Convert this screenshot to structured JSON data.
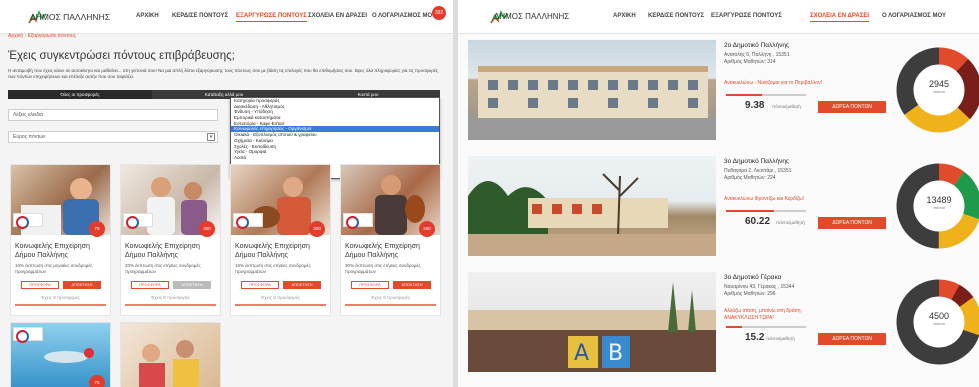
{
  "brand": {
    "name": "ΔΗΜΟΣ ΠΑΛΛΗΝΗΣ",
    "colors": {
      "accent": "#e14a2b",
      "badge": "#e53b2c",
      "dark": "#3a3a3a"
    }
  },
  "nav": [
    {
      "label": "ΑΡΧΙΚΗ"
    },
    {
      "label": "ΚΕΡΔΙΣΕ ΠΟΝΤΟΥΣ"
    },
    {
      "label": "ΕΞΑΡΓΥΡΩΣΕ ΠΟΝΤΟΥΣ"
    },
    {
      "label": "ΣΧΟΛΕΙΑ ΕΝ ΔΡΑΣΕΙ"
    },
    {
      "label": "Ο ΛΟΓΑΡΙΑΣΜΟΣ ΜΟΥ"
    }
  ],
  "account_badge": "392",
  "breadcrumb": {
    "home": "Αρχική",
    "current": "Εξαργύρωσε πόντους"
  },
  "left": {
    "title": "Έχεις συγκεντρώσει πόντους επιβράβευσης;",
    "intro": "Η ανταμοιβή που έχεις κάνει σε αυτοκίνητο και μαθαίνει... στη γειτονιά σου! Να μια απλή λίστα εξαργύρωσης τους πόντους σου με βάση τις επιλογές που θα επιθυμήσεις σου. Βρες όλα πληροφορίες για τις προσφορές των πόντων επιχειρήσεων και επέλεξε αυτήν που σου ταιριάζει.",
    "tabs": [
      {
        "label": "Όλες οι προσφορές"
      },
      {
        "label": "Κατάταξη αλλά μου"
      },
      {
        "label": "Κοντά μου"
      }
    ],
    "search_placeholder": "Λέξεις κλειδιά",
    "range_select": "Εύρος πόντων",
    "dropdown": [
      "Κατηγορία προσφοράς",
      "Διασκέδαση - Αθλητισμός",
      "Ένδυση - Υπόδηση",
      "Εμπορικά καταστήματα",
      "Εστιατόρια - Καφε-Εστιατ",
      "Κοινωφελείς επιχειρήσεις - Οργανισμοί",
      "Οικιακά - Εξοπλισμός σπιτιού & γραφείου",
      "Οχήματα - Καύσιμα",
      "Σχολές - Εκπαίδευση",
      "Υγεία - Ομορφιά",
      "Λοιπά"
    ],
    "cards": [
      {
        "title": "Κοινωφελής Επιχείρηση Δήμου Παλλήνης",
        "desc": "10% έκπτωση στις μηνιαίες συνδρομές προγραμμάτων",
        "discount": "75",
        "btn_info": "ΠΡΟΣΦΟΡΑ",
        "btn_redeem": "ΑΠΟΚΤΗΣΗ",
        "foot": "Έχεις 8 προσφορές"
      },
      {
        "title": "Κοινωφελής Επιχείρηση Δήμου Παλλήνης",
        "desc": "20% έκπτωση στις ετήσιες συνδρομές προγραμμάτων",
        "discount": "300",
        "btn_info": "ΠΡΟΣΦΟΡΑ",
        "btn_redeem": "ΑΠΟΚΤΗΣΗ",
        "foot": "Έχεις 8 προσφορές"
      },
      {
        "title": "Κοινωφελής Επιχείρηση Δήμου Παλλήνης",
        "desc": "15% έκπτωση στις ετήσιες συνδρομές προγραμμάτων",
        "discount": "300",
        "btn_info": "ΠΡΟΣΦΟΡΑ",
        "btn_redeem": "ΑΠΟΚΤΗΣΗ",
        "foot": "Έχεις 8 προσφορές"
      },
      {
        "title": "Κοινωφελής Επιχείρηση Δήμου Παλλήνης",
        "desc": "30% έκπτωση στις ετήσιες συνδρομές προγραμμάτων",
        "discount": "250",
        "btn_info": "ΠΡΟΣΦΟΡΑ",
        "btn_redeem": "ΑΠΟΚΤΗΣΗ",
        "foot": "Έχεις 8 προσφορές"
      }
    ],
    "extra_discount": "75"
  },
  "schools": [
    {
      "name": "2ο Δημοτικό Παλλήνης",
      "addr1": "Ανατολής 6, Παλλήνη , 15351",
      "addr2": "Αριθμός Μαθητών: 314",
      "quote": "Ανακυκλώνω - Νοιάζομαι για το Περιβάλλον!",
      "progress": 0.45,
      "score": "9.38",
      "unit": "πόντοι/μαθητή",
      "button": "ΔΩΡΕΑ ΠΟΝΤΩΝ",
      "total": "2945",
      "total_label": "πόντοι",
      "slices": [
        0.12,
        0.25,
        0.28,
        0.35
      ],
      "colors": [
        "#e14a2b",
        "#7a1e1a",
        "#f0b21a",
        "#3d3d3d"
      ]
    },
    {
      "name": "3ο Δημοτικό Παλλήνης",
      "addr1": "Πυθαγόρα 2, Λεοντάρι , 15351",
      "addr2": "Αριθμός Μαθητών: 224",
      "quote": "Ανακυκλώνω Φροντίζω και Κερδίζω!",
      "progress": 0.6,
      "score": "60.22",
      "unit": "πόντοι/μαθητή",
      "button": "ΔΩΡΕΑ ΠΟΝΤΩΝ",
      "total": "13489",
      "total_label": "πόντοι",
      "slices": [
        0.1,
        0.2,
        0.2,
        0.5
      ],
      "colors": [
        "#e14a2b",
        "#1f9a4a",
        "#f0b21a",
        "#3d3d3d"
      ]
    },
    {
      "name": "3ο Δημοτικό Γέρακα",
      "addr1": "Ναυαρίνου 43, Γέρακας , 15344",
      "addr2": "Αριθμός Μαθητών: 296",
      "quote": "Αλλάζω στάση, μπαίνω στη δράση: ΑΝΑΚΥΚΛΩΣΗ ΤΩΡΑ!",
      "progress": 0.2,
      "score": "15.2",
      "unit": "πόντοι/μαθητή",
      "button": "ΔΩΡΕΑ ΠΟΝΤΩΝ",
      "total": "4500",
      "total_label": "πόντοι",
      "slices": [
        0.08,
        0.07,
        0.15,
        0.7
      ],
      "colors": [
        "#e14a2b",
        "#7a1e1a",
        "#f0b21a",
        "#3d3d3d"
      ]
    }
  ]
}
